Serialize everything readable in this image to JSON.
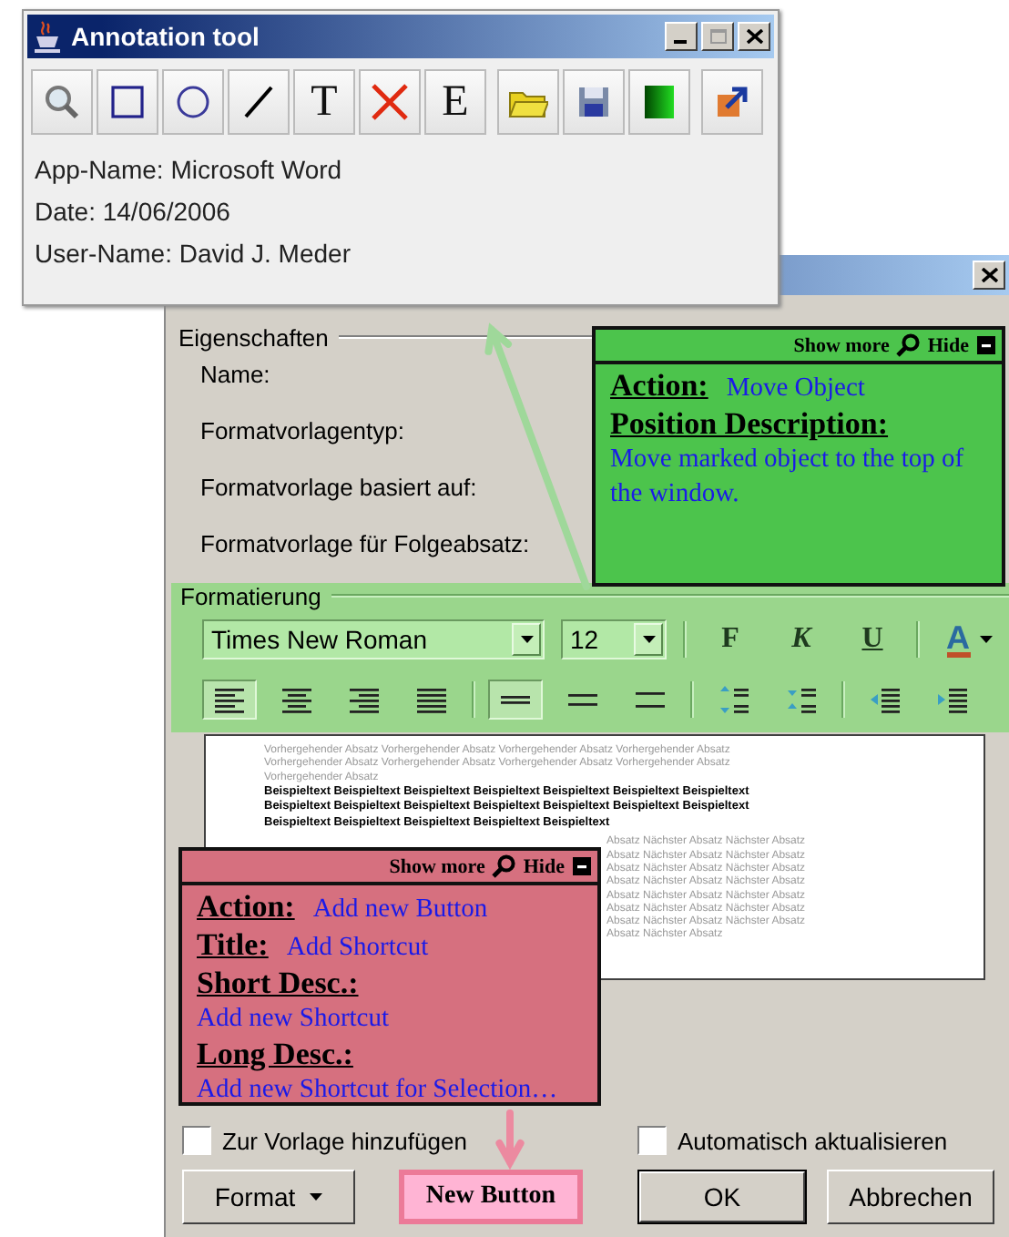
{
  "annotation_tool": {
    "title": "Annotation tool",
    "tool_groups": [
      [
        {
          "kind": "zoom"
        },
        {
          "kind": "rectangle"
        },
        {
          "kind": "ellipse"
        },
        {
          "kind": "line"
        },
        {
          "kind": "text",
          "glyph": "T"
        },
        {
          "kind": "delete"
        },
        {
          "kind": "letter",
          "glyph": "E"
        }
      ],
      [
        {
          "kind": "open"
        },
        {
          "kind": "save"
        },
        {
          "kind": "color"
        }
      ],
      [
        {
          "kind": "export"
        }
      ]
    ],
    "info": [
      "App-Name: Microsoft Word",
      "Date: 14/06/2006",
      "User-Name: David J. Meder"
    ]
  },
  "dialog": {
    "properties": {
      "title": "Eigenschaften",
      "labels": [
        "Name:",
        "Formatvorlagentyp:",
        "Formatvorlage basiert auf:",
        "Formatvorlage für Folgeabsatz:"
      ]
    },
    "formatting": {
      "title": "Formatierung",
      "highlighted": true,
      "font": "Times New Roman",
      "size": "12",
      "styles": [
        {
          "kind": "bold",
          "glyph": "F"
        },
        {
          "kind": "italic",
          "glyph": "K"
        },
        {
          "kind": "underline",
          "glyph": "U"
        }
      ],
      "font_color": {
        "glyph": "A"
      },
      "alignment": [
        {
          "kind": "left",
          "selected": true
        },
        {
          "kind": "center",
          "selected": false
        },
        {
          "kind": "right",
          "selected": false
        },
        {
          "kind": "justify",
          "selected": false
        }
      ],
      "line_spacing": [
        {
          "kind": "single",
          "selected": true
        },
        {
          "kind": "onehalf",
          "selected": false
        },
        {
          "kind": "double",
          "selected": false
        }
      ],
      "paragraph_tools": [
        {
          "kind": "space-more"
        },
        {
          "kind": "space-less"
        },
        {
          "kind": "indent-less"
        },
        {
          "kind": "indent-more"
        }
      ]
    },
    "preview": {
      "previous": [
        "Vorhergehender Absatz Vorhergehender Absatz Vorhergehender Absatz Vorhergehender Absatz",
        "Vorhergehender Absatz Vorhergehender Absatz Vorhergehender Absatz Vorhergehender Absatz",
        "Vorhergehender Absatz"
      ],
      "sample": [
        "Beispieltext Beispieltext Beispieltext Beispieltext Beispieltext Beispieltext Beispieltext",
        "Beispieltext Beispieltext Beispieltext Beispieltext Beispieltext Beispieltext Beispieltext",
        "Beispieltext Beispieltext Beispieltext Beispieltext Beispieltext"
      ],
      "next": [
        "Absatz Nächster Absatz Nächster Absatz",
        "Absatz Nächster Absatz Nächster Absatz",
        "Absatz Nächster Absatz Nächster Absatz",
        "Absatz Nächster Absatz Nächster Absatz",
        "Absatz Nächster Absatz Nächster Absatz",
        "Absatz Nächster Absatz Nächster Absatz",
        "Absatz Nächster Absatz Nächster Absatz",
        "Absatz Nächster Absatz"
      ]
    },
    "checkboxes": [
      {
        "label": "Zur Vorlage hinzufügen",
        "checked": false
      },
      {
        "label": "Automatisch aktualisieren",
        "checked": false
      }
    ],
    "buttons": [
      {
        "kind": "menu",
        "label": "Format",
        "highlighted": false
      },
      {
        "kind": "plain",
        "label": "New Button",
        "highlighted": true
      },
      {
        "kind": "default",
        "label": "OK",
        "highlighted": false
      },
      {
        "kind": "plain",
        "label": "Abbrechen",
        "highlighted": false
      }
    ]
  },
  "annotations": [
    {
      "color": "#4cc44c",
      "show_more": "Show more",
      "hide": "Hide",
      "entries": [
        {
          "kind": "inline",
          "label": "Action:",
          "value": "Move Object"
        },
        {
          "kind": "stacked",
          "label": "Position Description:",
          "value": "Move marked object to the top of the window."
        }
      ]
    },
    {
      "color": "#d6707f",
      "show_more": "Show more",
      "hide": "Hide",
      "entries": [
        {
          "kind": "inline",
          "label": "Action:",
          "value": "Add new Button"
        },
        {
          "kind": "inline",
          "label": "Title:",
          "value": "Add Shortcut"
        },
        {
          "kind": "stacked",
          "label": "Short Desc.:",
          "value": "Add new Shortcut"
        },
        {
          "kind": "stacked",
          "label": "Long Desc.:",
          "value": "Add new Shortcut for Selection…"
        }
      ]
    }
  ]
}
